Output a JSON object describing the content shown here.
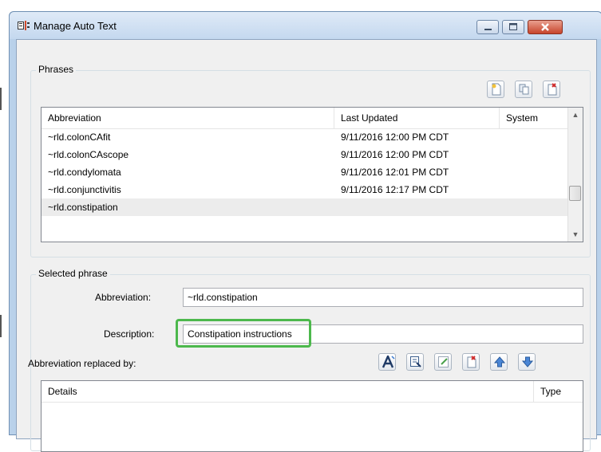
{
  "window": {
    "title": "Manage Auto Text"
  },
  "phrases": {
    "legend": "Phrases",
    "toolbar": {
      "new_icon": "new-document-icon",
      "copy_icon": "copy-document-icon",
      "delete_icon": "delete-document-icon"
    },
    "columns": [
      "Abbreviation",
      "Last Updated",
      "System"
    ],
    "rows": [
      {
        "abbreviation": "~rld.colonCAfit",
        "last_updated": "9/11/2016 12:00 PM CDT",
        "system": ""
      },
      {
        "abbreviation": "~rld.colonCAscope",
        "last_updated": "9/11/2016 12:00 PM CDT",
        "system": ""
      },
      {
        "abbreviation": "~rld.condylomata",
        "last_updated": "9/11/2016 12:01 PM CDT",
        "system": ""
      },
      {
        "abbreviation": "~rld.conjunctivitis",
        "last_updated": "9/11/2016 12:17 PM CDT",
        "system": ""
      },
      {
        "abbreviation": "~rld.constipation",
        "last_updated": "",
        "system": ""
      }
    ],
    "selected_index": 4
  },
  "selected_phrase": {
    "legend": "Selected phrase",
    "abbreviation_label": "Abbreviation:",
    "abbreviation_value": "~rld.constipation",
    "description_label": "Description:",
    "description_value": "Constipation instructions",
    "replaced_by_label": "Abbreviation replaced by:",
    "details_columns": [
      "Details",
      "Type"
    ]
  },
  "colors": {
    "highlight": "#4cb84c",
    "close_button": "#c7442b"
  }
}
